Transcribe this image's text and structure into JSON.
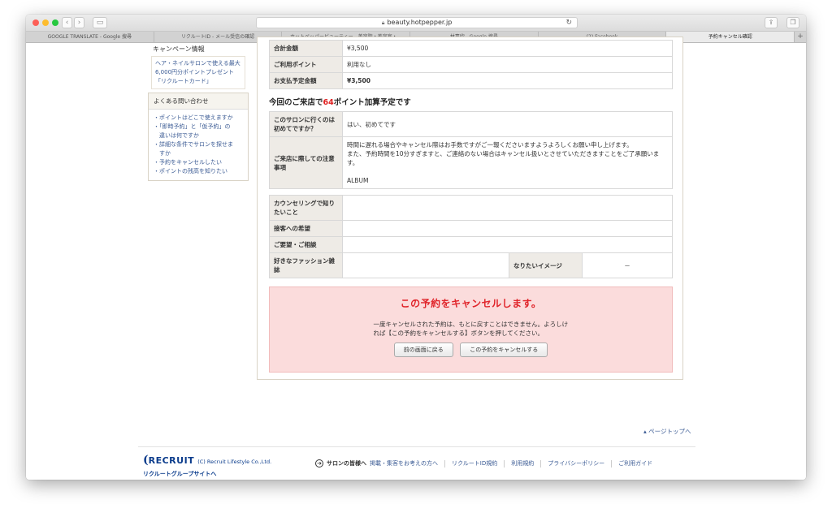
{
  "browser": {
    "url": "beauty.hotpepper.jp",
    "tabs": [
      "GOOGLE TRANSLATE - Google 搜尋",
      "リクルートID - メール受信の確認",
      "ホットペッパービューティー - 美容院・美容室・...",
      "林嘉欣 - Google 搜尋",
      "(2) Facebook",
      "予約キャンセル確認"
    ],
    "new_tab": "+"
  },
  "sidebar": {
    "campaign_title": "キャンペーン情報",
    "campaign_link": "ヘア・ネイルサロンで使える最大6,000円分ポイントプレゼント「リクルートカード」",
    "faq_title": "よくある問い合わせ",
    "faq_items": [
      "・ポイントはどこで使えますか",
      "・「即時予約」と「仮予約」の",
      "　違いは何ですか",
      "・詳細な条件でサロンを探せま",
      "　すか",
      "・予約をキャンセルしたい",
      "・ポイントの残高を知りたい"
    ]
  },
  "summary": {
    "rows": [
      {
        "label": "合計金額",
        "value": "¥3,500"
      },
      {
        "label": "ご利用ポイント",
        "value": "利用なし"
      },
      {
        "label": "お支払予定金額",
        "value": "¥3,500"
      }
    ]
  },
  "points": {
    "prefix": "今回のご来店で",
    "number": "64",
    "suffix": "ポイント加算予定です"
  },
  "visit": {
    "first_label": "このサロンに行くのは初めてですか？",
    "first_value": "はい、初めてです",
    "notes_label": "ご来店に際しての注意事項",
    "notes_line1": "時間に遅れる場合やキャンセル際はお手数ですがご一報くださいますようよろしくお願い申し上げます。",
    "notes_line2": "また、予約時間を10分すぎますと、ご連絡のない場合はキャンセル扱いとさせていただきますことをご了承願います。",
    "notes_line3": "ALBUM"
  },
  "requests": {
    "counseling_label": "カウンセリングで知りたいこと",
    "counseling_value": "",
    "service_label": "接客への希望",
    "service_value": "",
    "wishes_label": "ご要望・ご相談",
    "wishes_value": "",
    "magazine_label": "好きなファッション雑誌",
    "magazine_value": "",
    "image_label": "なりたいイメージ",
    "image_value": "－"
  },
  "cancel": {
    "title": "この予約をキャンセルします。",
    "desc": "一度キャンセルされた予約は、もとに戻すことはできません。よろしければ【この予約をキャンセルする】ボタンを押してください。",
    "back_button": "前の画面に戻る",
    "cancel_button": "この予約をキャンセルする"
  },
  "footer": {
    "page_top": "ページトップへ",
    "logo_text": "RECRUIT",
    "copyright": "(C) Recruit Lifestyle Co.,Ltd.",
    "group_link": "リクルートグループサイトへ",
    "salon_label": "サロンの皆様へ",
    "links": [
      "掲載・集客をお考えの方へ",
      "リクルートID規約",
      "利用規約",
      "プライバシーポリシー",
      "ご利用ガイド"
    ]
  },
  "colors": {
    "accent_red": "#e0242a",
    "link_blue": "#3b5b94",
    "cancel_bg": "#fbdcdc"
  }
}
